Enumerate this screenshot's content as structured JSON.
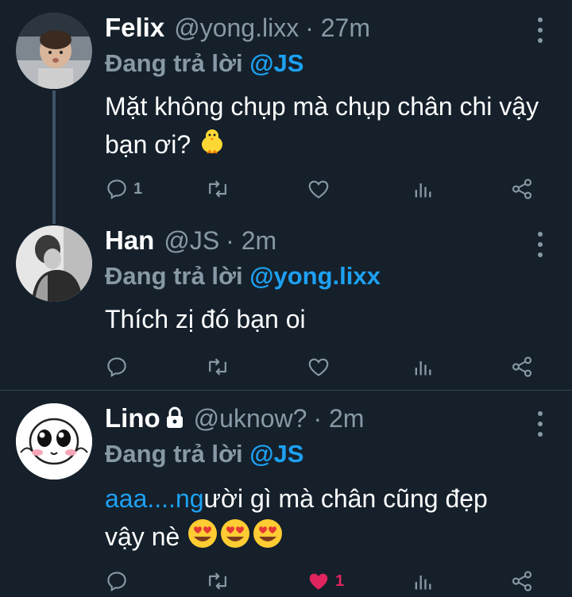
{
  "tweets": [
    {
      "name": "Felix",
      "handle": "@yong.lixx",
      "time": "· 27m",
      "replying_prefix": "Đang trả lời ",
      "replying_to": "@JS",
      "text": "Mặt không chụp mà chụp chân chi vậy bạn ơi?",
      "emoji": [
        "chick-emoji"
      ],
      "reply_count": "1",
      "like_count": "",
      "liked": false
    },
    {
      "name": "Han",
      "handle": "@JS",
      "time": "· 2m",
      "replying_prefix": "Đang trả lời ",
      "replying_to": "@yong.lixx",
      "text": "Thích zị đó bạn oi",
      "emoji": [],
      "reply_count": "",
      "like_count": "",
      "liked": false
    },
    {
      "name": "Lino",
      "handle": "@uknow?",
      "time": "· 2m",
      "replying_prefix": "Đang trả lời ",
      "replying_to": "@JS",
      "text_link": "aaa....ng",
      "text_rest": "ười gì mà chân cũng đẹp",
      "text_line2": "vậy nè",
      "emoji": [
        "heart-eyes-emoji",
        "heart-eyes-emoji",
        "heart-eyes-emoji"
      ],
      "protected": true,
      "reply_count": "",
      "like_count": "1",
      "liked": true
    }
  ],
  "colors": {
    "background": "#15202b",
    "secondary_text": "#8899a6",
    "accent": "#1da1f2",
    "like": "#e0245e"
  }
}
